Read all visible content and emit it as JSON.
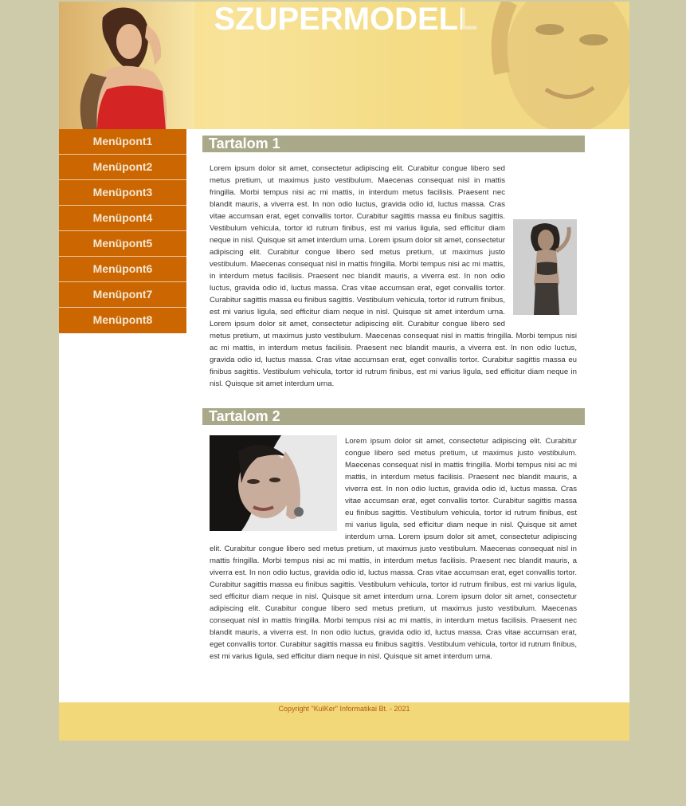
{
  "header": {
    "title": "SZUPERMODELL"
  },
  "menu": {
    "items": [
      {
        "label": "Menüpont1"
      },
      {
        "label": "Menüpont2"
      },
      {
        "label": "Menüpont3"
      },
      {
        "label": "Menüpont4"
      },
      {
        "label": "Menüpont5"
      },
      {
        "label": "Menüpont6"
      },
      {
        "label": "Menüpont7"
      },
      {
        "label": "Menüpont8"
      }
    ]
  },
  "sections": [
    {
      "title": "Tartalom 1",
      "text": "Lorem ipsum dolor sit amet, consectetur adipiscing elit. Curabitur congue libero sed metus pretium, ut maximus justo vestibulum. Maecenas consequat nisl in mattis fringilla. Morbi tempus nisi ac mi mattis, in interdum metus facilisis. Praesent nec blandit mauris, a viverra est. In non odio luctus, gravida odio id, luctus massa. Cras vitae accumsan erat, eget convallis tortor. Curabitur sagittis massa eu finibus sagittis. Vestibulum vehicula, tortor id rutrum finibus, est mi varius ligula, sed efficitur diam neque in nisl. Quisque sit amet interdum urna. Lorem ipsum dolor sit amet, consectetur adipiscing elit. Curabitur congue libero sed metus pretium, ut maximus justo vestibulum. Maecenas consequat nisl in mattis fringilla. Morbi tempus nisi ac mi mattis, in interdum metus facilisis. Praesent nec blandit mauris, a viverra est. In non odio luctus, gravida odio id, luctus massa. Cras vitae accumsan erat, eget convallis tortor. Curabitur sagittis massa eu finibus sagittis. Vestibulum vehicula, tortor id rutrum finibus, est mi varius ligula, sed efficitur diam neque in nisl. Quisque sit amet interdum urna. Lorem ipsum dolor sit amet, consectetur adipiscing elit. Curabitur congue libero sed metus pretium, ut maximus justo vestibulum. Maecenas consequat nisl in mattis fringilla. Morbi tempus nisi ac mi mattis, in interdum metus facilisis. Praesent nec blandit mauris, a viverra est. In non odio luctus, gravida odio id, luctus massa. Cras vitae accumsan erat, eget convallis tortor. Curabitur sagittis massa eu finibus sagittis. Vestibulum vehicula, tortor id rutrum finibus, est mi varius ligula, sed efficitur diam neque in nisl. Quisque sit amet interdum urna."
    },
    {
      "title": "Tartalom 2",
      "text": "Lorem ipsum dolor sit amet, consectetur adipiscing elit. Curabitur congue libero sed metus pretium, ut maximus justo vestibulum. Maecenas consequat nisl in mattis fringilla. Morbi tempus nisi ac mi mattis, in interdum metus facilisis. Praesent nec blandit mauris, a viverra est. In non odio luctus, gravida odio id, luctus massa. Cras vitae accumsan erat, eget convallis tortor. Curabitur sagittis massa eu finibus sagittis. Vestibulum vehicula, tortor id rutrum finibus, est mi varius ligula, sed efficitur diam neque in nisl. Quisque sit amet interdum urna. Lorem ipsum dolor sit amet, consectetur adipiscing elit. Curabitur congue libero sed metus pretium, ut maximus justo vestibulum. Maecenas consequat nisl in mattis fringilla. Morbi tempus nisi ac mi mattis, in interdum metus facilisis. Praesent nec blandit mauris, a viverra est. In non odio luctus, gravida odio id, luctus massa. Cras vitae accumsan erat, eget convallis tortor. Curabitur sagittis massa eu finibus sagittis. Vestibulum vehicula, tortor id rutrum finibus, est mi varius ligula, sed efficitur diam neque in nisl. Quisque sit amet interdum urna. Lorem ipsum dolor sit amet, consectetur adipiscing elit. Curabitur congue libero sed metus pretium, ut maximus justo vestibulum. Maecenas consequat nisl in mattis fringilla. Morbi tempus nisi ac mi mattis, in interdum metus facilisis. Praesent nec blandit mauris, a viverra est. In non odio luctus, gravida odio id, luctus massa. Cras vitae accumsan erat, eget convallis tortor. Curabitur sagittis massa eu finibus sagittis. Vestibulum vehicula, tortor id rutrum finibus, est mi varius ligula, sed efficitur diam neque in nisl. Quisque sit amet interdum urna."
    }
  ],
  "footer": {
    "copyright": "Copyright \"KulKer\" Informatikai Bt. - 2021"
  },
  "colors": {
    "page_background": "#cdcba9",
    "header_background": "#f5d97e",
    "menu_background": "#cc6600",
    "section_title_background": "#a9a98a",
    "footer_background": "#f2d878",
    "footer_text": "#b2581c"
  },
  "images": {
    "header_left": "woman-in-red-top-photo",
    "header_right": "smiling-woman-face-photo",
    "section1": "model-standing-photo",
    "section2": "woman-hand-on-face-photo"
  }
}
